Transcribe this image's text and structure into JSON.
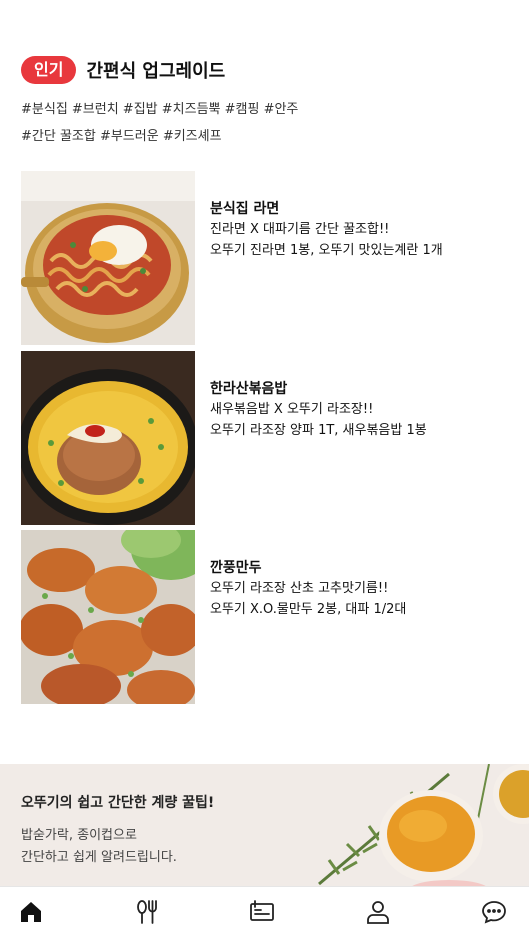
{
  "section": {
    "badge": "인기",
    "title": "간편식 업그레이드",
    "tags_line1": "#분식집 #브런치 #집밥 #치즈듬뿍 #캠핑 #안주",
    "tags_line2": "#간단 꿀조합 #부드러운 #키즈셰프"
  },
  "recipes": [
    {
      "name": "분식집 라면",
      "desc": "진라면 X 대파기름 간단 꿀조합!!",
      "ingredients": "오뚜기 진라면 1봉, 오뚜기 맛있는계란 1개"
    },
    {
      "name": "한라산볶음밥",
      "desc": "새우볶음밥 X 오뚜기 라조장!!",
      "ingredients": "오뚜기 라조장 양파 1T, 새우볶음밥 1봉"
    },
    {
      "name": "깐풍만두",
      "desc": "오뚜기 라조장 산초 고추맛기름!!",
      "ingredients": "오뚜기 X.O.물만두 2봉, 대파 1/2대"
    }
  ],
  "banner": {
    "title": "오뚜기의 쉽고 간단한 계량 꿀팁!",
    "desc_line1": "밥숟가락, 종이컵으로",
    "desc_line2": "간단하고 쉽게 알려드립니다."
  },
  "tabbar": {
    "icons": [
      "home-icon",
      "fork-knife-icon",
      "recipe-card-icon",
      "user-icon",
      "chat-icon"
    ]
  },
  "colors": {
    "badge": "#e8383d",
    "banner_bg": "#f1ebe7",
    "tab_active": "#111111"
  }
}
